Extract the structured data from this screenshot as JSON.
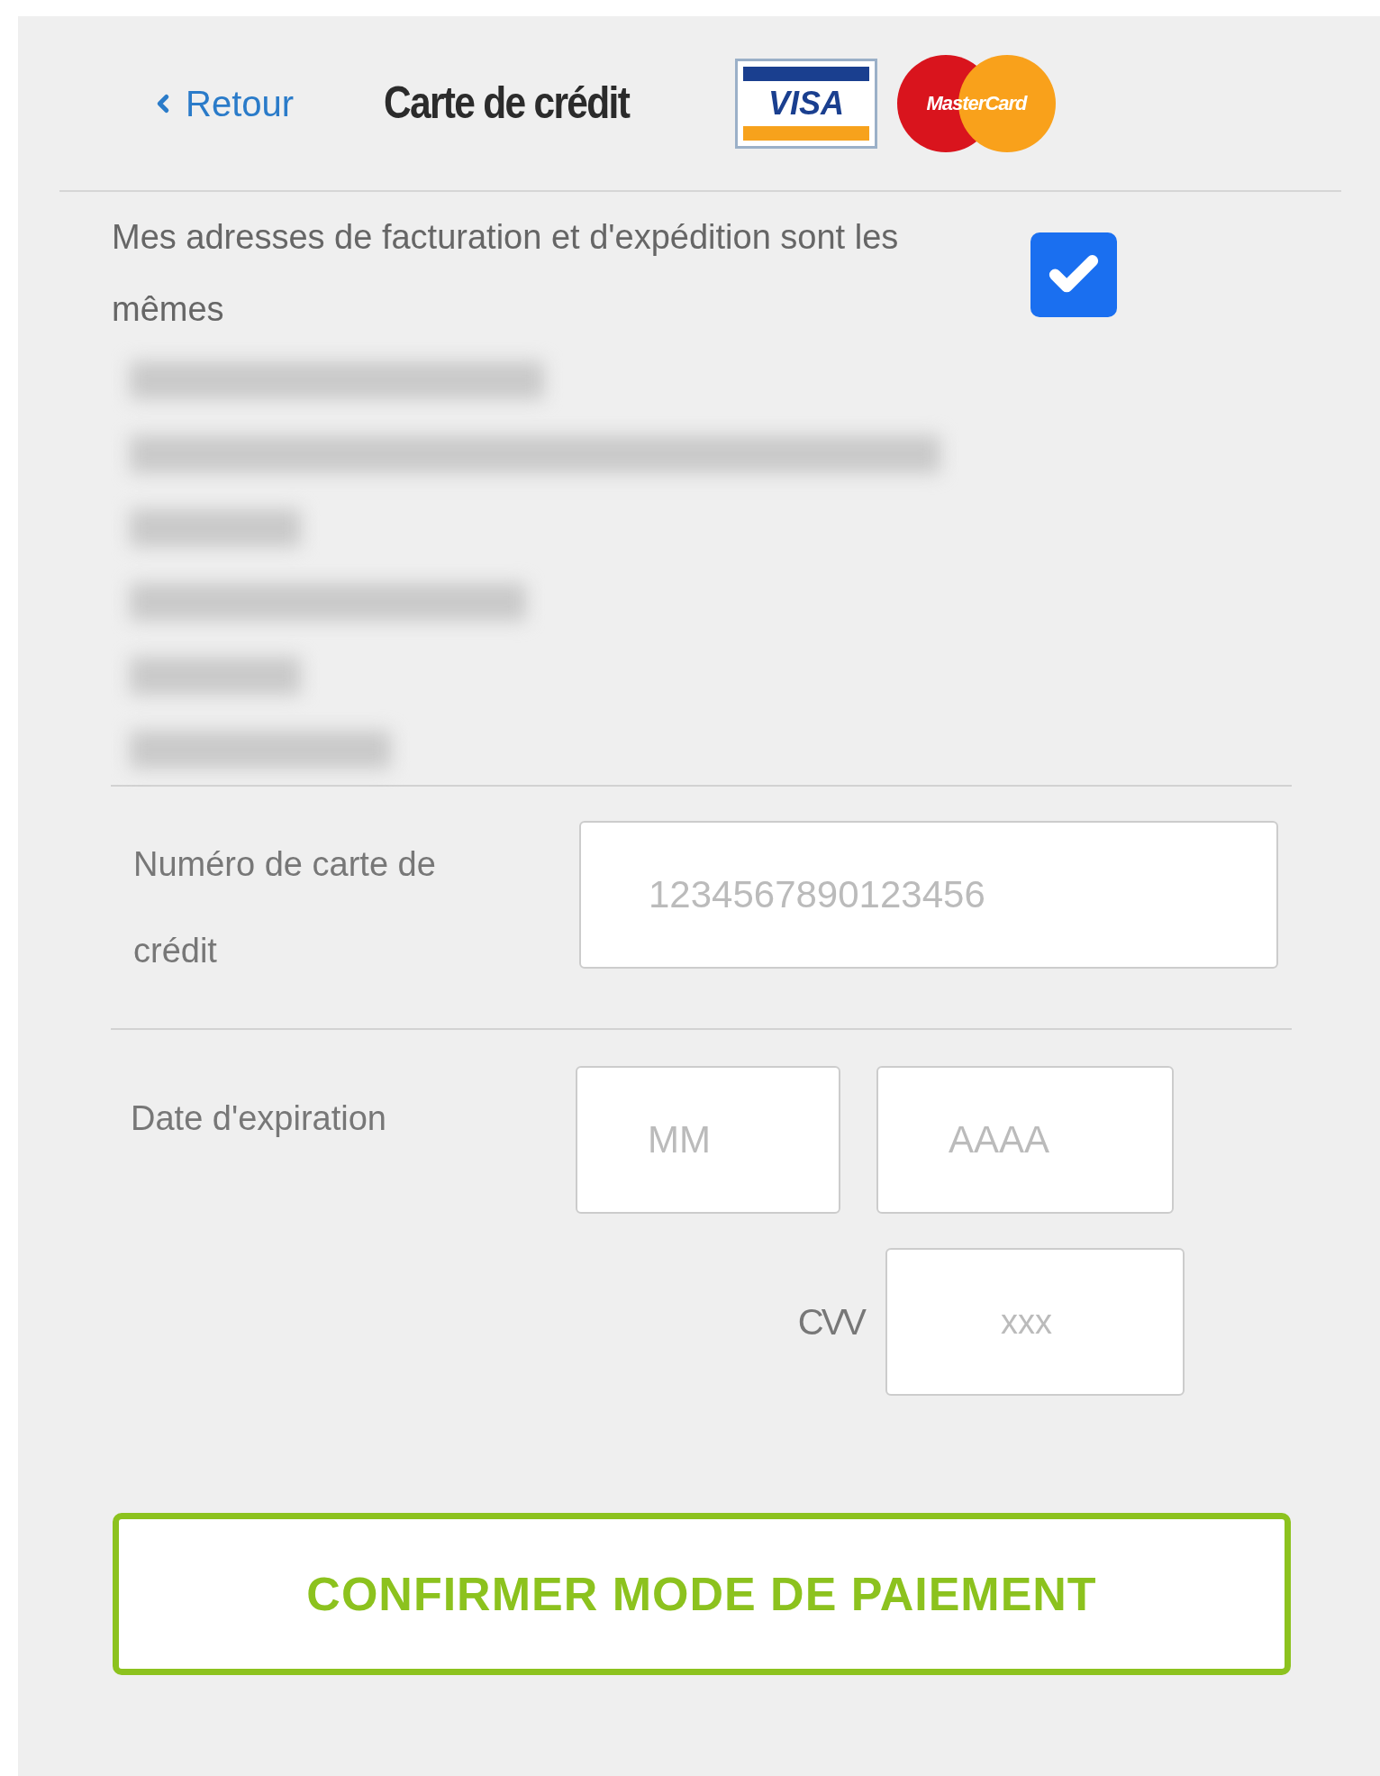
{
  "header": {
    "back_link": "Retour",
    "title": "Carte de crédit"
  },
  "logos": [
    {
      "kind": "visa",
      "label": "VISA"
    },
    {
      "kind": "mastercard",
      "label": "MasterCard"
    }
  ],
  "same_address": {
    "label": "Mes adresses de facturation et d'expédition sont les mêmes",
    "checked": true
  },
  "card_number": {
    "label": "Numéro de carte de crédit",
    "placeholder": "1234567890123456"
  },
  "expiry": {
    "label": "Date d'expiration",
    "month_placeholder": "MM",
    "year_placeholder": "AAAA"
  },
  "cvv": {
    "label": "CVV",
    "placeholder": "xxx"
  },
  "submit": "CONFIRMER MODE DE PAIEMENT"
}
